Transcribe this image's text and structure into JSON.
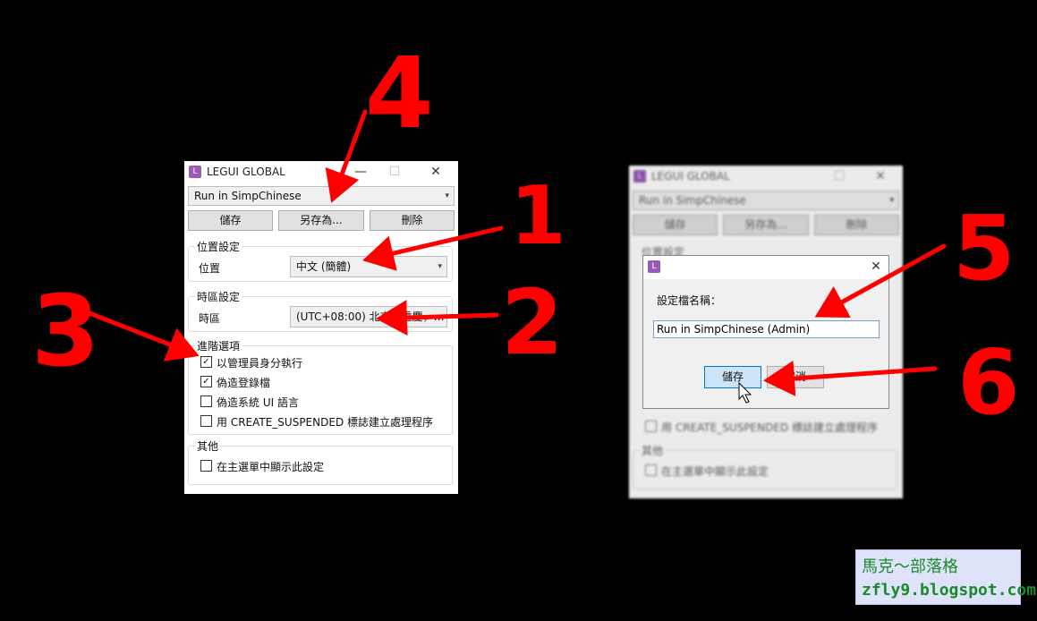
{
  "left_window": {
    "title": "LEGUI GLOBAL",
    "app_icon": "L",
    "controls": {
      "minimize": "—",
      "maximize": "☐",
      "close": "✕"
    },
    "profile_select": "Run in SimpChinese",
    "buttons": {
      "save": "儲存",
      "save_as": "另存為...",
      "delete": "刪除"
    },
    "location_group": {
      "label": "位置設定",
      "field_label": "位置",
      "value": "中文 (簡體)"
    },
    "timezone_group": {
      "label": "時區設定",
      "field_label": "時區",
      "value": "(UTC+08:00) 北京，重慶，…"
    },
    "advanced_group": {
      "label": "進階選項",
      "options": [
        {
          "label": "以管理員身分執行",
          "checked": true
        },
        {
          "label": "偽造登錄檔",
          "checked": true
        },
        {
          "label": "偽造系統 UI 語言",
          "checked": false
        },
        {
          "label": "用 CREATE_SUSPENDED 標誌建立處理程序",
          "checked": false
        }
      ]
    },
    "other_group": {
      "label": "其他",
      "options": [
        {
          "label": "在主選單中顯示此設定",
          "checked": false
        }
      ]
    }
  },
  "right_window": {
    "title": "LEGUI GLOBAL",
    "app_icon": "L",
    "profile_select": "Run in SimpChinese",
    "buttons": {
      "save": "儲存",
      "save_as": "另存為...",
      "delete": "刪除"
    },
    "location_group_label": "位置設定",
    "advanced_last_option": "用 CREATE_SUSPENDED 標誌建立處理程序",
    "other_group": {
      "label": "其他",
      "option": "在主選單中顯示此設定"
    }
  },
  "save_dialog": {
    "app_icon": "L",
    "close": "✕",
    "prompt": "設定檔名稱：",
    "name_value": "Run in SimpChinese (Admin)",
    "ok_button": "儲存",
    "cancel_button": "取消"
  },
  "annotations": {
    "step1": "1",
    "step2": "2",
    "step3": "3",
    "step4": "4",
    "step5": "5",
    "step6": "6",
    "color": "#ff0000"
  },
  "watermark": {
    "line1": "馬克～部落格",
    "line2": "zfly9.blogspot.com",
    "text_color": "#1a8a2a",
    "bg_color": "#dfe3fa"
  }
}
